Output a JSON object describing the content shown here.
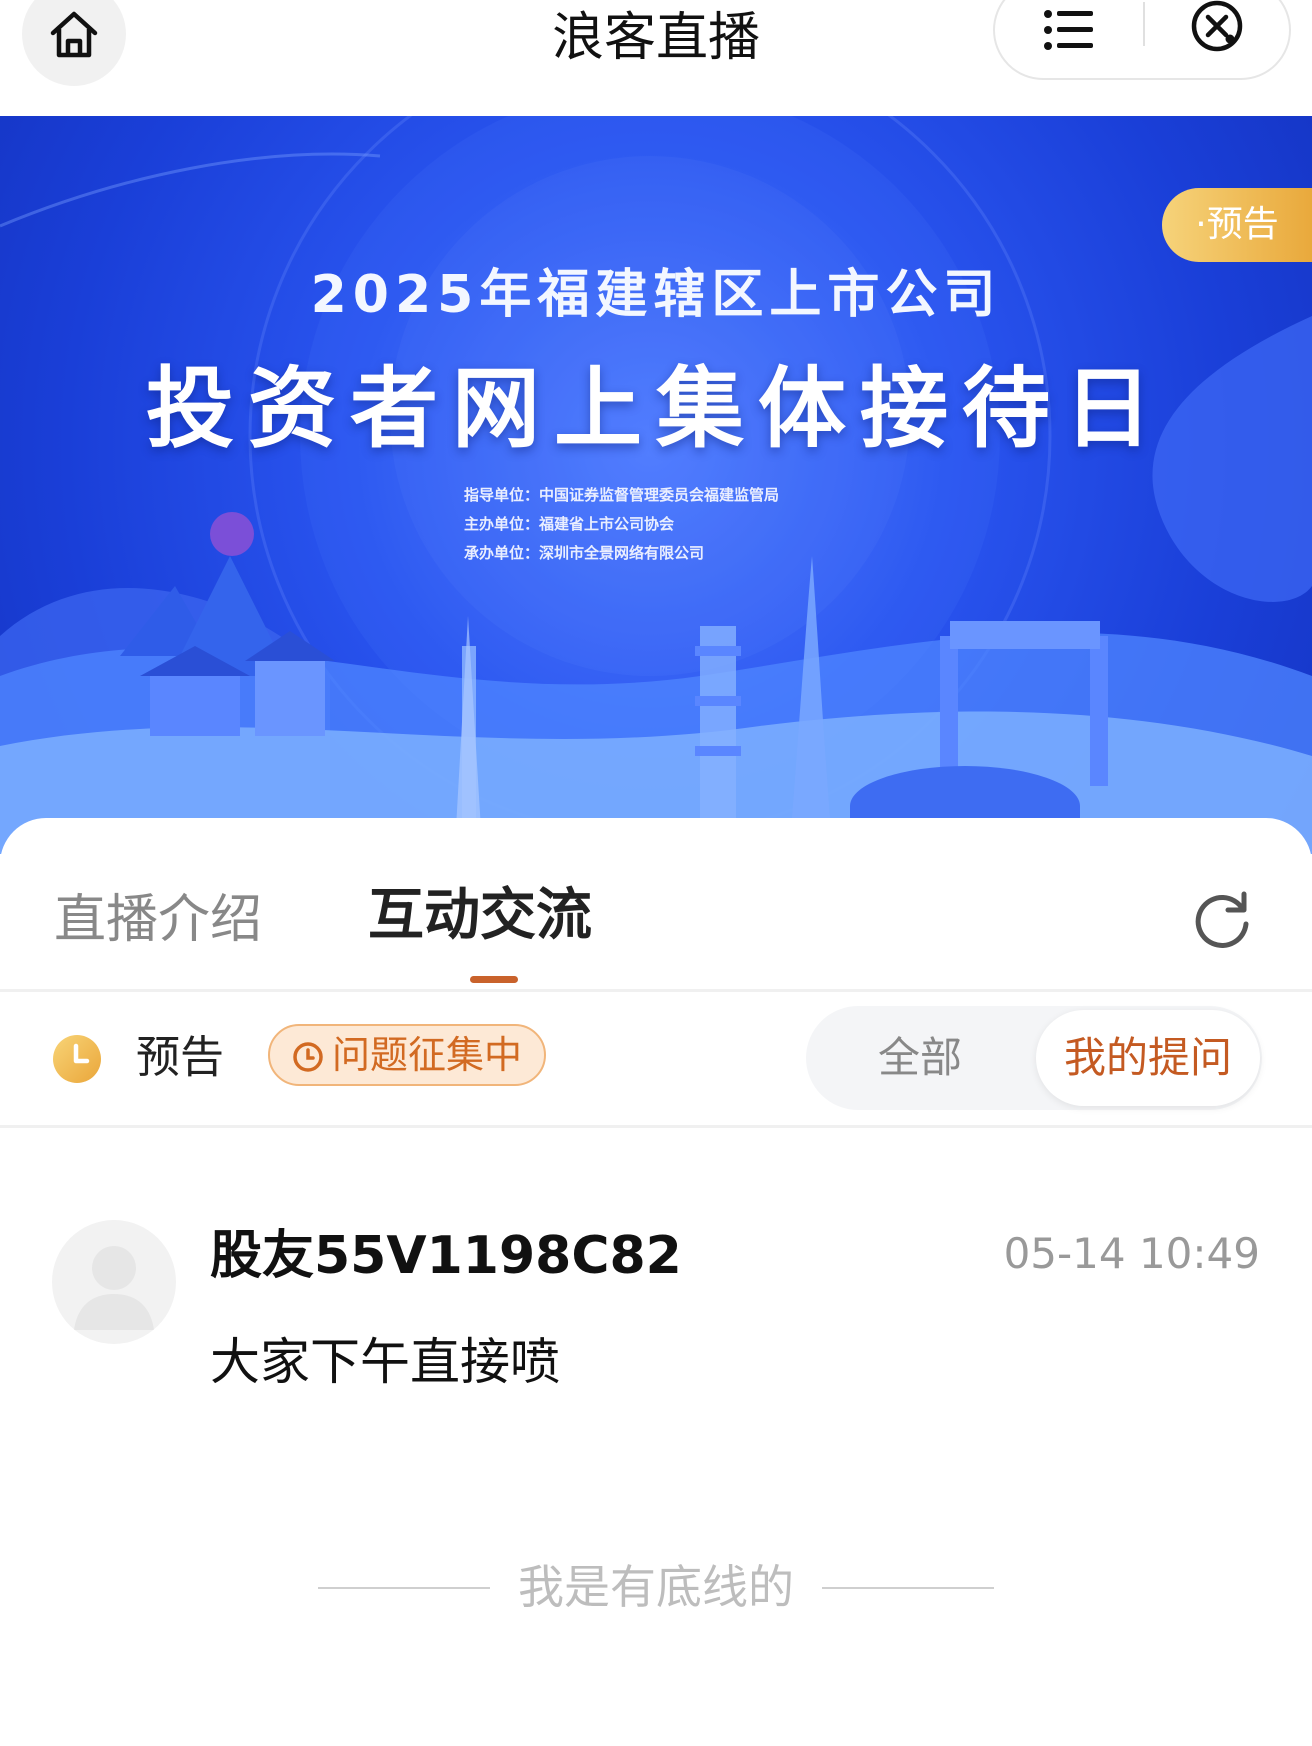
{
  "nav": {
    "title": "浪客直播"
  },
  "banner": {
    "badge": "·预告",
    "title_line1": "2025年福建辖区上市公司",
    "title_line2": "投资者网上集体接待日",
    "org_lines": [
      "指导单位：中国证券监督管理委员会福建监管局",
      "主办单位：福建省上市公司协会",
      "承办单位：深圳市全景网络有限公司"
    ]
  },
  "tabs": {
    "intro": "直播介绍",
    "chat": "互动交流"
  },
  "status": {
    "label": "预告",
    "tag": "问题征集中"
  },
  "filter": {
    "all": "全部",
    "mine": "我的提问"
  },
  "post": {
    "username": "股友55V1198C82",
    "time": "05-14 10:49",
    "content": "大家下午直接喷"
  },
  "footer": {
    "bottom_line": "我是有底线的"
  },
  "colors": {
    "accent": "#c9622b",
    "banner_blue": "#2a55f0",
    "badge_gold": "#e9a93c"
  },
  "icons": [
    "home-icon",
    "menu-icon",
    "close-icon",
    "refresh-icon",
    "clock-icon",
    "timer-icon",
    "avatar-icon"
  ]
}
